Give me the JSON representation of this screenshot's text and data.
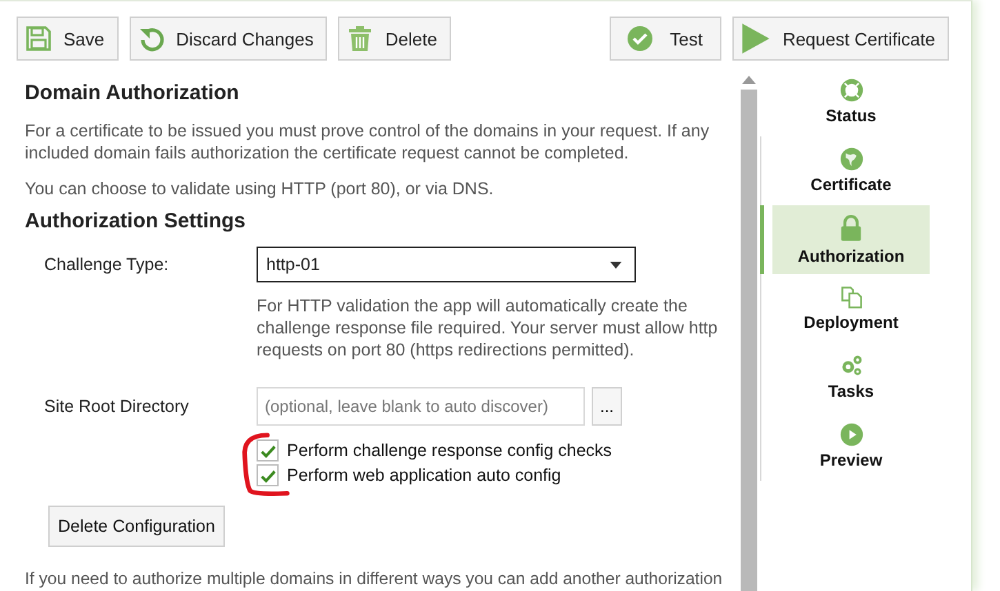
{
  "toolbar": {
    "left": [
      {
        "kind": "save",
        "label": "Save"
      },
      {
        "kind": "discard",
        "label": "Discard Changes"
      },
      {
        "kind": "delete",
        "label": "Delete"
      }
    ],
    "right": [
      {
        "kind": "test",
        "label": "Test"
      },
      {
        "kind": "request",
        "label": "Request Certificate"
      }
    ]
  },
  "content": {
    "heading": "Domain Authorization",
    "intro": "For a certificate to be issued you must prove control of the domains in your request. If any included domain fails authorization the certificate request cannot be completed.",
    "choice_note": "You can choose to validate using HTTP (port 80), or via DNS.",
    "settings_heading": "Authorization Settings",
    "challenge_type": {
      "label": "Challenge Type:",
      "value": "http-01"
    },
    "challenge_help": "For HTTP validation the app will automatically create the challenge response file required. Your server must allow http requests on port 80 (https redirections permitted).",
    "site_root": {
      "label": "Site Root Directory",
      "placeholder": "(optional, leave blank to auto discover)",
      "browse_button": "..."
    },
    "checkboxes": [
      {
        "label": "Perform challenge response config checks",
        "checked": true
      },
      {
        "label": "Perform web application auto config",
        "checked": true
      }
    ],
    "delete_button": "Delete Configuration",
    "footer_note": "If you need to authorize multiple domains in different ways you can add another authorization"
  },
  "sidebar": {
    "items": [
      {
        "kind": "status",
        "label": "Status",
        "selected": false
      },
      {
        "kind": "certificate",
        "label": "Certificate",
        "selected": false
      },
      {
        "kind": "authorization",
        "label": "Authorization",
        "selected": true
      },
      {
        "kind": "deployment",
        "label": "Deployment",
        "selected": false
      },
      {
        "kind": "tasks",
        "label": "Tasks",
        "selected": false
      },
      {
        "kind": "preview",
        "label": "Preview",
        "selected": false
      }
    ]
  }
}
